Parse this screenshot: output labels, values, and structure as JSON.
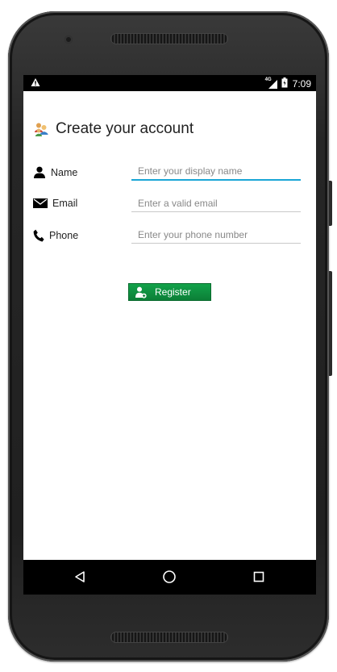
{
  "status_bar": {
    "warning_icon": "warning-icon",
    "network": "4G",
    "time": "7:09"
  },
  "header": {
    "icon": "users-icon",
    "title": "Create your account"
  },
  "form": {
    "name": {
      "label": "Name",
      "icon": "person-icon",
      "placeholder": "Enter your display name",
      "value": ""
    },
    "email": {
      "label": "Email",
      "icon": "envelope-icon",
      "placeholder": "Enter a valid email",
      "value": ""
    },
    "phone": {
      "label": "Phone",
      "icon": "phone-icon",
      "placeholder": "Enter your phone number",
      "value": ""
    },
    "register": {
      "label": "Register",
      "icon": "add-user-icon"
    }
  },
  "nav": {
    "back": "back-icon",
    "home": "home-icon",
    "recents": "recents-icon"
  },
  "colors": {
    "accent": "#1aa6d6",
    "button": "#0f8f40"
  }
}
